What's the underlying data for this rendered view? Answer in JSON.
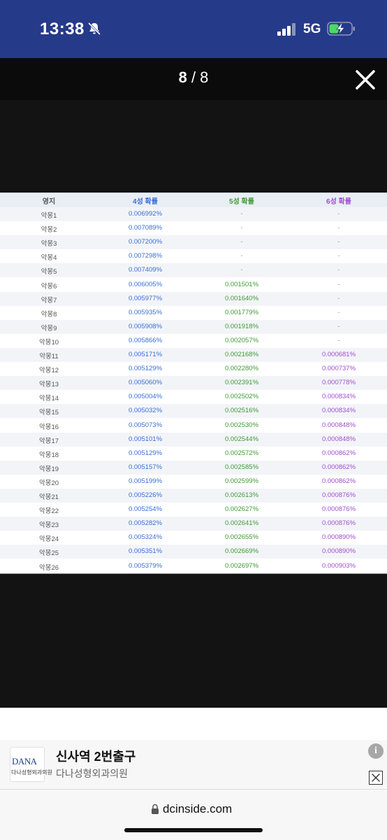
{
  "status_bar": {
    "time": "13:38",
    "network": "5G"
  },
  "viewer": {
    "current_page": "8",
    "separator": " / ",
    "total_pages": "8"
  },
  "table": {
    "headers": [
      "영지",
      "4성 확률",
      "5성 확률",
      "6성 확률"
    ],
    "rows": [
      [
        "악몽1",
        "0.006992%",
        "-",
        "-"
      ],
      [
        "악몽2",
        "0.007089%",
        "-",
        "-"
      ],
      [
        "악몽3",
        "0.007200%",
        "-",
        "-"
      ],
      [
        "악몽4",
        "0.007298%",
        "-",
        "-"
      ],
      [
        "악몽5",
        "0.007409%",
        "-",
        "-"
      ],
      [
        "악몽6",
        "0.006005%",
        "0.001501%",
        "-"
      ],
      [
        "악몽7",
        "0.005977%",
        "0.001640%",
        "-"
      ],
      [
        "악몽8",
        "0.005935%",
        "0.001779%",
        "-"
      ],
      [
        "악몽9",
        "0.005908%",
        "0.001918%",
        "-"
      ],
      [
        "악몽10",
        "0.005866%",
        "0.002057%",
        "-"
      ],
      [
        "악몽11",
        "0.005171%",
        "0.002168%",
        "0.000681%"
      ],
      [
        "악몽12",
        "0.005129%",
        "0.002280%",
        "0.000737%"
      ],
      [
        "악몽13",
        "0.005060%",
        "0.002391%",
        "0.000778%"
      ],
      [
        "악몽14",
        "0.005004%",
        "0.002502%",
        "0.000834%"
      ],
      [
        "악몽15",
        "0.005032%",
        "0.002516%",
        "0.000834%"
      ],
      [
        "악몽16",
        "0.005073%",
        "0.002530%",
        "0.000848%"
      ],
      [
        "악몽17",
        "0.005101%",
        "0.002544%",
        "0.000848%"
      ],
      [
        "악몽18",
        "0.005129%",
        "0.002572%",
        "0.000862%"
      ],
      [
        "악몽19",
        "0.005157%",
        "0.002585%",
        "0.000862%"
      ],
      [
        "악몽20",
        "0.005199%",
        "0.002599%",
        "0.000862%"
      ],
      [
        "악몽21",
        "0.005226%",
        "0.002613%",
        "0.000876%"
      ],
      [
        "악몽22",
        "0.005254%",
        "0.002627%",
        "0.000876%"
      ],
      [
        "악몽23",
        "0.005282%",
        "0.002641%",
        "0.000876%"
      ],
      [
        "악몽24",
        "0.005324%",
        "0.002655%",
        "0.000890%"
      ],
      [
        "악몽25",
        "0.005351%",
        "0.002669%",
        "0.000890%"
      ],
      [
        "악몽26",
        "0.005379%",
        "0.002697%",
        "0.000903%"
      ]
    ]
  },
  "ad": {
    "logo_text": "DANA",
    "logo_subtext": "다나성형외과의원",
    "title": "신사역 2번출구",
    "subtitle": "다나성형외과의원",
    "info_label": "i"
  },
  "browser": {
    "url": "dcinside.com"
  },
  "colors": {
    "status_bar_bg": "#263a8a",
    "header_text": "#2f66c6",
    "col4": "#3a6fd0",
    "col5": "#3f9a34",
    "col6": "#a04fd0"
  },
  "icons": [
    "bell-slash-icon",
    "signal-icon",
    "battery-charging-icon",
    "close-icon",
    "info-icon",
    "ad-close-icon",
    "lock-icon"
  ]
}
